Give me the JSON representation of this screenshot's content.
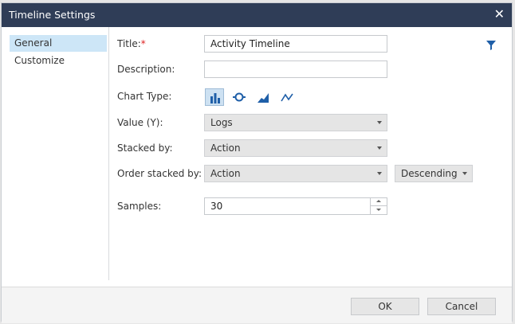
{
  "window": {
    "title": "Timeline Settings",
    "close_glyph": "✕"
  },
  "sidebar": {
    "items": [
      {
        "label": "General"
      },
      {
        "label": "Customize"
      }
    ]
  },
  "form": {
    "title": {
      "label": "Title:",
      "required_mark": "*",
      "value": "Activity Timeline"
    },
    "description": {
      "label": "Description:",
      "value": ""
    },
    "chart_type": {
      "label": "Chart Type:",
      "options": [
        "bar-chart-icon",
        "loop-icon",
        "area-chart-icon",
        "line-chart-icon"
      ],
      "selected": "bar-chart-icon"
    },
    "value_y": {
      "label": "Value (Y):",
      "value": "Logs"
    },
    "stacked_by": {
      "label": "Stacked by:",
      "value": "Action"
    },
    "order_stacked_by": {
      "label": "Order stacked by:",
      "value": "Action",
      "order": "Descending"
    },
    "samples": {
      "label": "Samples:",
      "value": "30"
    }
  },
  "icons": {
    "filter": "filter-icon"
  },
  "colors": {
    "titlebar": "#2f3d57",
    "selection": "#cde6f7",
    "accent": "#1f5fa8"
  },
  "footer": {
    "ok_label": "OK",
    "cancel_label": "Cancel"
  }
}
